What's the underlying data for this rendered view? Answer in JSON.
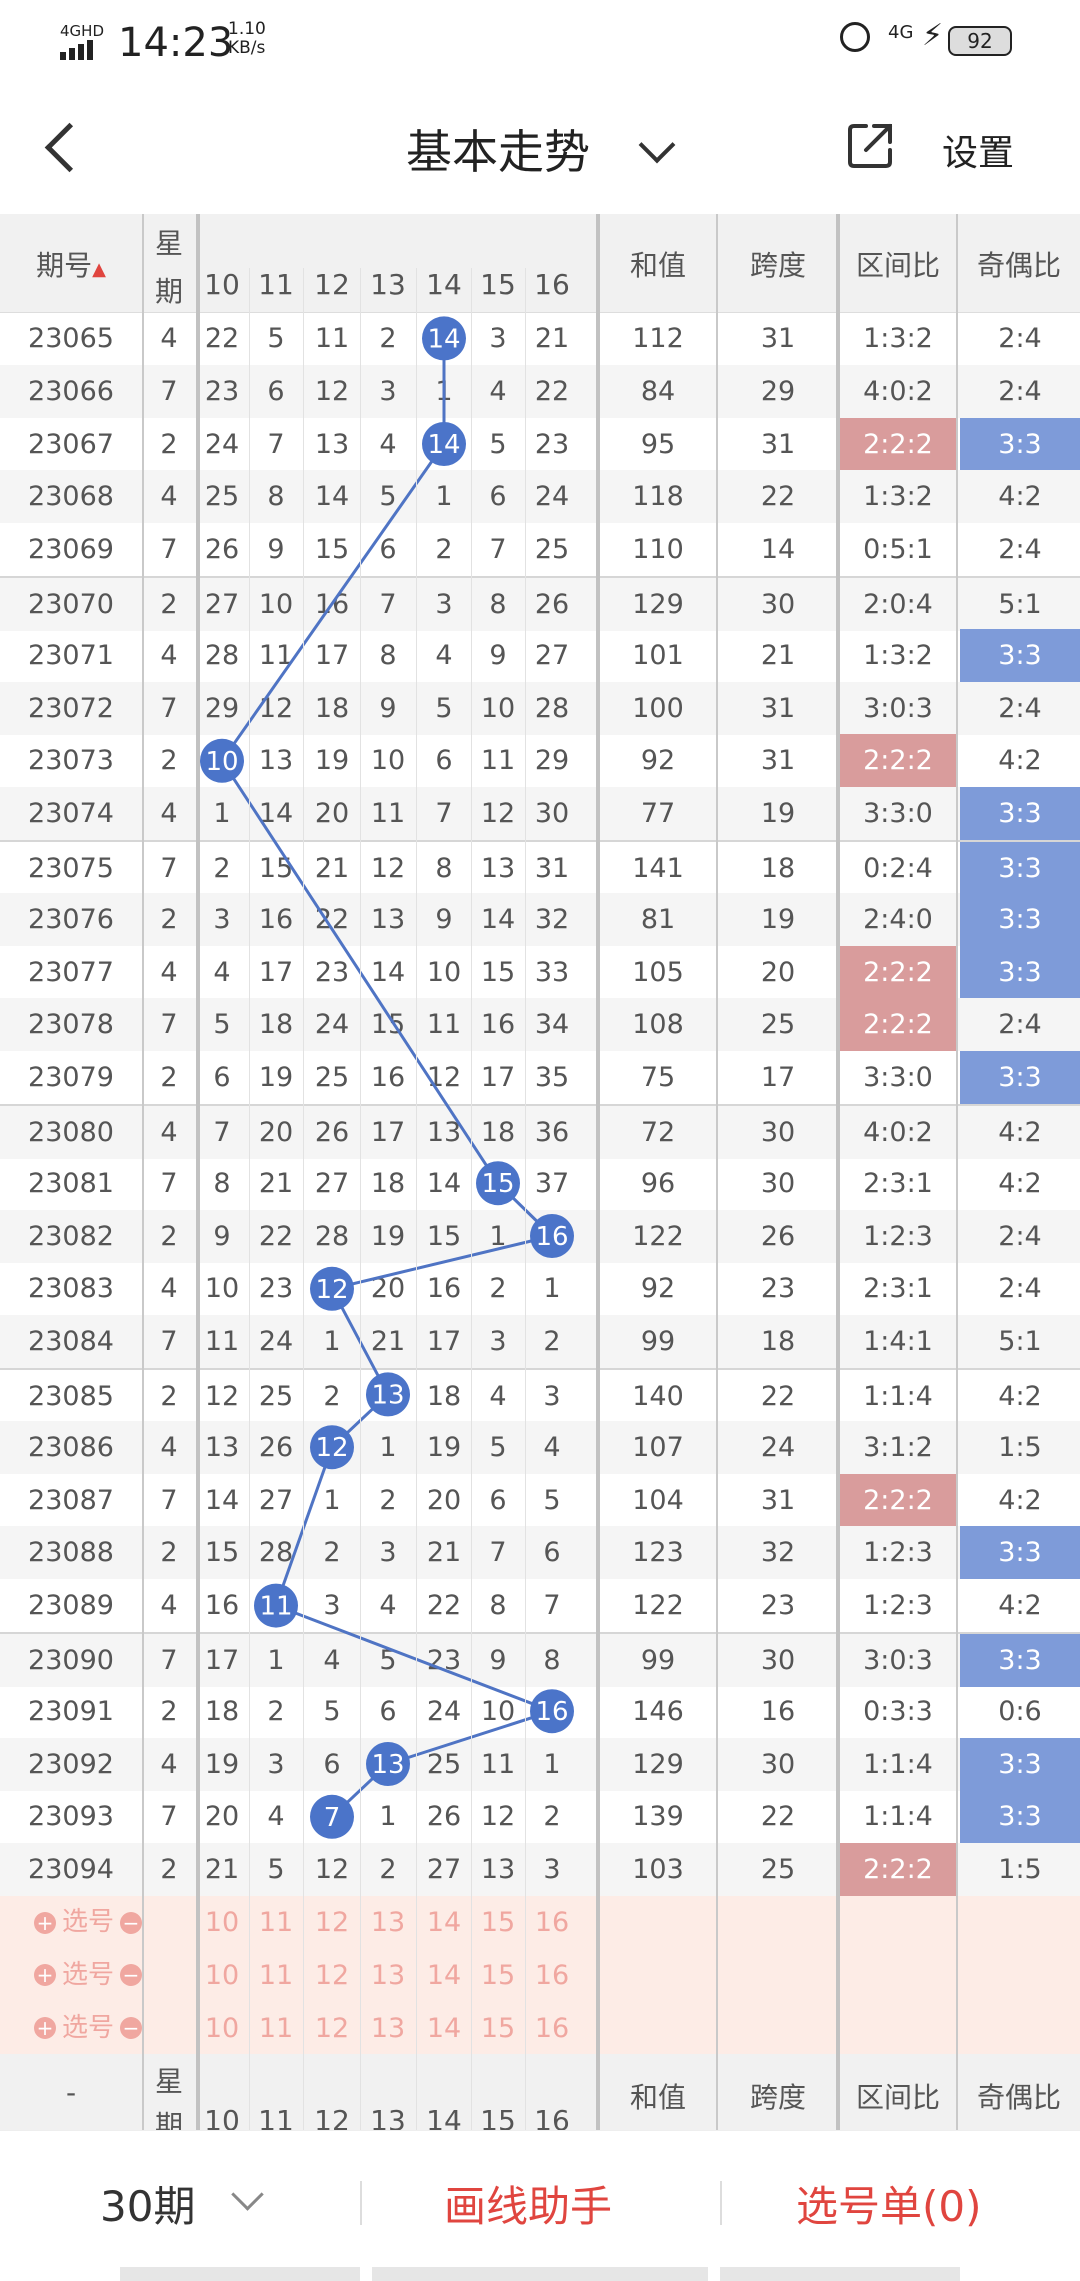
{
  "status": {
    "network": "4GHD",
    "time": "14:23",
    "speed_value": "1.10",
    "speed_unit": "KB/s",
    "net2": "4G",
    "battery": "92"
  },
  "header": {
    "title": "基本走势",
    "settings_label": "设置"
  },
  "table": {
    "col_period": "期号",
    "col_week_top": "星",
    "col_week_bottom": "期",
    "col_sum": "和值",
    "col_span": "跨度",
    "col_range": "区间比",
    "col_parity": "奇偶比",
    "num_headers": [
      "10",
      "11",
      "12",
      "13",
      "14",
      "15",
      "16"
    ],
    "rows": [
      {
        "p": "23065",
        "w": "4",
        "v": [
          "22",
          "5",
          "11",
          "2",
          "14",
          "3",
          "21"
        ],
        "s": "112",
        "k": "31",
        "r": "1:3:2",
        "o": "2:4"
      },
      {
        "p": "23066",
        "w": "7",
        "v": [
          "23",
          "6",
          "12",
          "3",
          "1",
          "4",
          "22"
        ],
        "s": "84",
        "k": "29",
        "r": "4:0:2",
        "o": "2:4"
      },
      {
        "p": "23067",
        "w": "2",
        "v": [
          "24",
          "7",
          "13",
          "4",
          "14",
          "5",
          "23"
        ],
        "s": "95",
        "k": "31",
        "r": "2:2:2",
        "o": "3:3"
      },
      {
        "p": "23068",
        "w": "4",
        "v": [
          "25",
          "8",
          "14",
          "5",
          "1",
          "6",
          "24"
        ],
        "s": "118",
        "k": "22",
        "r": "1:3:2",
        "o": "4:2"
      },
      {
        "p": "23069",
        "w": "7",
        "v": [
          "26",
          "9",
          "15",
          "6",
          "2",
          "7",
          "25"
        ],
        "s": "110",
        "k": "14",
        "r": "0:5:1",
        "o": "2:4"
      },
      {
        "p": "23070",
        "w": "2",
        "v": [
          "27",
          "10",
          "16",
          "7",
          "3",
          "8",
          "26"
        ],
        "s": "129",
        "k": "30",
        "r": "2:0:4",
        "o": "5:1"
      },
      {
        "p": "23071",
        "w": "4",
        "v": [
          "28",
          "11",
          "17",
          "8",
          "4",
          "9",
          "27"
        ],
        "s": "101",
        "k": "21",
        "r": "1:3:2",
        "o": "3:3"
      },
      {
        "p": "23072",
        "w": "7",
        "v": [
          "29",
          "12",
          "18",
          "9",
          "5",
          "10",
          "28"
        ],
        "s": "100",
        "k": "31",
        "r": "3:0:3",
        "o": "2:4"
      },
      {
        "p": "23073",
        "w": "2",
        "v": [
          "10",
          "13",
          "19",
          "10",
          "6",
          "11",
          "29"
        ],
        "s": "92",
        "k": "31",
        "r": "2:2:2",
        "o": "4:2"
      },
      {
        "p": "23074",
        "w": "4",
        "v": [
          "1",
          "14",
          "20",
          "11",
          "7",
          "12",
          "30"
        ],
        "s": "77",
        "k": "19",
        "r": "3:3:0",
        "o": "3:3"
      },
      {
        "p": "23075",
        "w": "7",
        "v": [
          "2",
          "15",
          "21",
          "12",
          "8",
          "13",
          "31"
        ],
        "s": "141",
        "k": "18",
        "r": "0:2:4",
        "o": "3:3"
      },
      {
        "p": "23076",
        "w": "2",
        "v": [
          "3",
          "16",
          "22",
          "13",
          "9",
          "14",
          "32"
        ],
        "s": "81",
        "k": "19",
        "r": "2:4:0",
        "o": "3:3"
      },
      {
        "p": "23077",
        "w": "4",
        "v": [
          "4",
          "17",
          "23",
          "14",
          "10",
          "15",
          "33"
        ],
        "s": "105",
        "k": "20",
        "r": "2:2:2",
        "o": "3:3"
      },
      {
        "p": "23078",
        "w": "7",
        "v": [
          "5",
          "18",
          "24",
          "15",
          "11",
          "16",
          "34"
        ],
        "s": "108",
        "k": "25",
        "r": "2:2:2",
        "o": "2:4"
      },
      {
        "p": "23079",
        "w": "2",
        "v": [
          "6",
          "19",
          "25",
          "16",
          "12",
          "17",
          "35"
        ],
        "s": "75",
        "k": "17",
        "r": "3:3:0",
        "o": "3:3"
      },
      {
        "p": "23080",
        "w": "4",
        "v": [
          "7",
          "20",
          "26",
          "17",
          "13",
          "18",
          "36"
        ],
        "s": "72",
        "k": "30",
        "r": "4:0:2",
        "o": "4:2"
      },
      {
        "p": "23081",
        "w": "7",
        "v": [
          "8",
          "21",
          "27",
          "18",
          "14",
          "15",
          "37"
        ],
        "s": "96",
        "k": "30",
        "r": "2:3:1",
        "o": "4:2"
      },
      {
        "p": "23082",
        "w": "2",
        "v": [
          "9",
          "22",
          "28",
          "19",
          "15",
          "1",
          "16"
        ],
        "s": "122",
        "k": "26",
        "r": "1:2:3",
        "o": "2:4"
      },
      {
        "p": "23083",
        "w": "4",
        "v": [
          "10",
          "23",
          "12",
          "20",
          "16",
          "2",
          "1"
        ],
        "s": "92",
        "k": "23",
        "r": "2:3:1",
        "o": "2:4"
      },
      {
        "p": "23084",
        "w": "7",
        "v": [
          "11",
          "24",
          "1",
          "21",
          "17",
          "3",
          "2"
        ],
        "s": "99",
        "k": "18",
        "r": "1:4:1",
        "o": "5:1"
      },
      {
        "p": "23085",
        "w": "2",
        "v": [
          "12",
          "25",
          "2",
          "13",
          "18",
          "4",
          "3"
        ],
        "s": "140",
        "k": "22",
        "r": "1:1:4",
        "o": "4:2"
      },
      {
        "p": "23086",
        "w": "4",
        "v": [
          "13",
          "26",
          "12",
          "1",
          "19",
          "5",
          "4"
        ],
        "s": "107",
        "k": "24",
        "r": "3:1:2",
        "o": "1:5"
      },
      {
        "p": "23087",
        "w": "7",
        "v": [
          "14",
          "27",
          "1",
          "2",
          "20",
          "6",
          "5"
        ],
        "s": "104",
        "k": "31",
        "r": "2:2:2",
        "o": "4:2"
      },
      {
        "p": "23088",
        "w": "2",
        "v": [
          "15",
          "28",
          "2",
          "3",
          "21",
          "7",
          "6"
        ],
        "s": "123",
        "k": "32",
        "r": "1:2:3",
        "o": "3:3"
      },
      {
        "p": "23089",
        "w": "4",
        "v": [
          "16",
          "11",
          "3",
          "4",
          "22",
          "8",
          "7"
        ],
        "s": "122",
        "k": "23",
        "r": "1:2:3",
        "o": "4:2"
      },
      {
        "p": "23090",
        "w": "7",
        "v": [
          "17",
          "1",
          "4",
          "5",
          "23",
          "9",
          "8"
        ],
        "s": "99",
        "k": "30",
        "r": "3:0:3",
        "o": "3:3"
      },
      {
        "p": "23091",
        "w": "2",
        "v": [
          "18",
          "2",
          "5",
          "6",
          "24",
          "10",
          "16"
        ],
        "s": "146",
        "k": "16",
        "r": "0:3:3",
        "o": "0:6"
      },
      {
        "p": "23092",
        "w": "4",
        "v": [
          "19",
          "3",
          "6",
          "13",
          "25",
          "11",
          "1"
        ],
        "s": "129",
        "k": "30",
        "r": "1:1:4",
        "o": "3:3"
      },
      {
        "p": "23093",
        "w": "7",
        "v": [
          "20",
          "4",
          "7",
          "1",
          "26",
          "12",
          "2"
        ],
        "s": "139",
        "k": "22",
        "r": "1:1:4",
        "o": "3:3"
      },
      {
        "p": "23094",
        "w": "2",
        "v": [
          "21",
          "5",
          "12",
          "2",
          "27",
          "13",
          "3"
        ],
        "s": "103",
        "k": "25",
        "r": "2:2:2",
        "o": "1:5"
      }
    ],
    "hits": [
      [
        0,
        4
      ],
      [
        2,
        4
      ],
      [
        8,
        0
      ],
      [
        16,
        5
      ],
      [
        17,
        6
      ],
      [
        18,
        2
      ],
      [
        20,
        3
      ],
      [
        21,
        2
      ],
      [
        24,
        1
      ],
      [
        26,
        6
      ],
      [
        27,
        3
      ],
      [
        28,
        2
      ]
    ],
    "pick_label": "选号",
    "bottom_dash": "-"
  },
  "colors": {
    "hit_ball": "#4b74c9",
    "trend_line": "#4f74c4",
    "range_highlight": "#d99c9c",
    "parity_highlight": "#7e9bd9",
    "accent_red": "#e0453f"
  },
  "footer": {
    "period_label": "30期",
    "draw_helper": "画线助手",
    "selection": "选号单(0)"
  }
}
